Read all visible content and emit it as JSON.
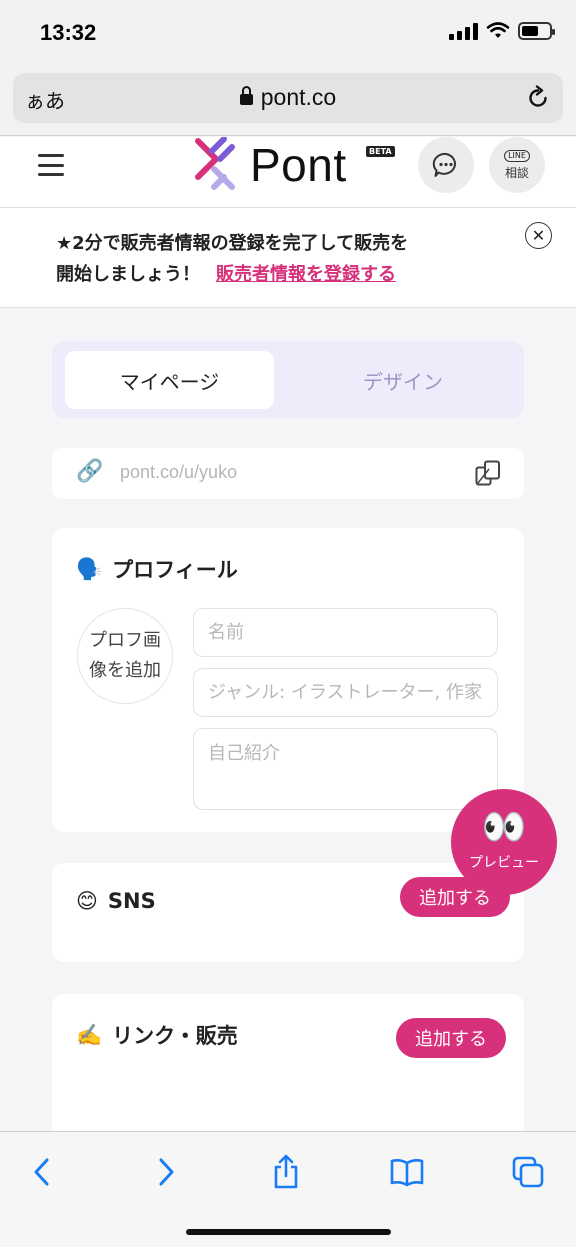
{
  "status_bar": {
    "time": "13:32"
  },
  "browser": {
    "text_size_label": "ぁあ",
    "domain": "pont.co"
  },
  "header": {
    "logo_text": "Pont",
    "badge": "BETA",
    "line_tag": "LINE",
    "line_label": "相談"
  },
  "banner": {
    "line1": "★2分で販売者情報の登録を完了して販売を",
    "line2": "開始しましょう！",
    "link_text": "販売者情報を登録する",
    "close": "✕"
  },
  "tabs": [
    {
      "label": "マイページ",
      "active": true
    },
    {
      "label": "デザイン",
      "active": false
    }
  ],
  "profile_url": "pont.co/u/yuko",
  "profile": {
    "icon": "🗣️",
    "title": "プロフィール",
    "avatar_line1": "プロフ画",
    "avatar_line2": "像を追加",
    "name_placeholder": "名前",
    "genre_placeholder": "ジャンル: イラストレーター, 作家",
    "bio_placeholder": "自己紹介"
  },
  "preview": {
    "eyes": "👀",
    "label": "プレビュー"
  },
  "sns": {
    "icon": "😊",
    "title": "SNS",
    "add_label": "追加する"
  },
  "links": {
    "icon": "✍️",
    "title": "リンク・販売",
    "add_label": "追加する"
  },
  "colors": {
    "accent": "#d6317a",
    "tab_bg": "#eeebfb",
    "tab_inactive_text": "#9c96c4",
    "ios_blue": "#1a7cf5"
  }
}
